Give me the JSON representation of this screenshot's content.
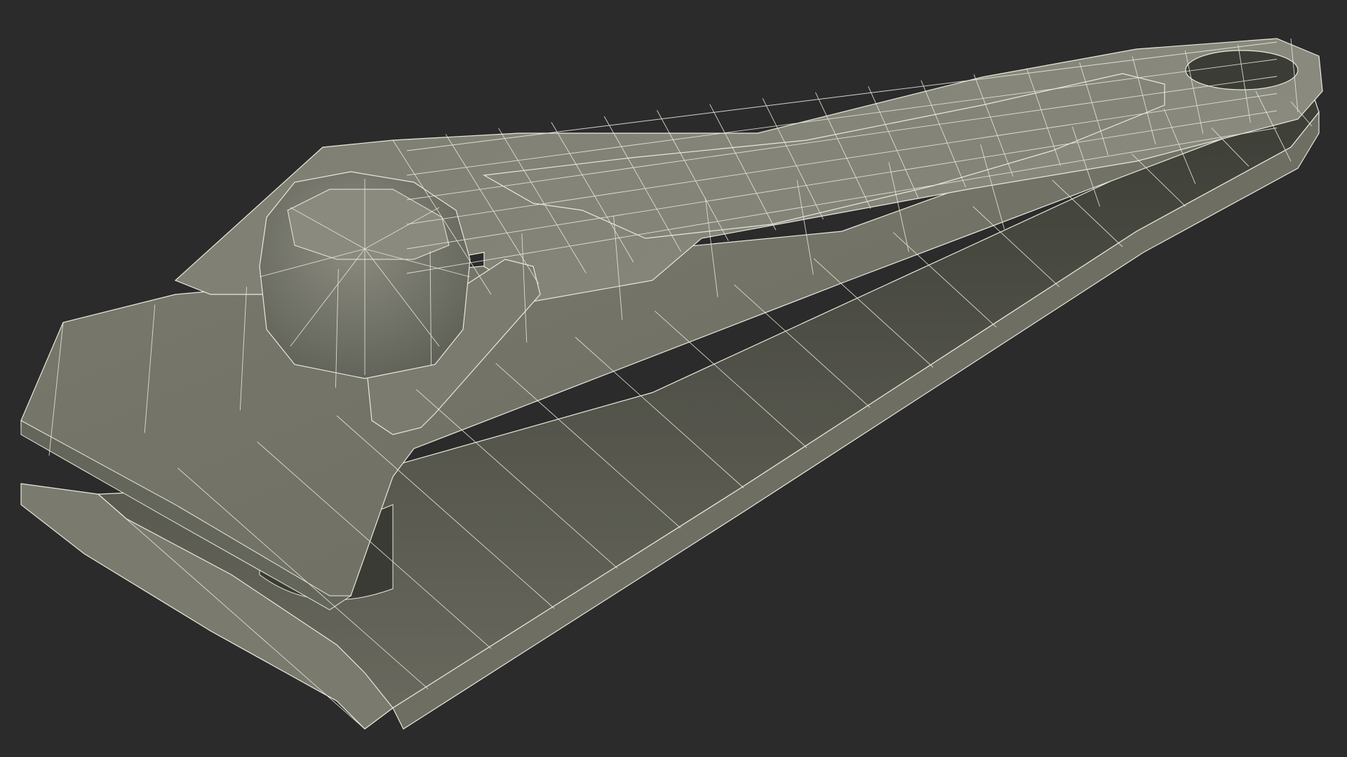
{
  "render": {
    "subject": "nail-clipper-wireframe",
    "background_color": "#2b2b2b",
    "surface_color": "#7d7d72",
    "shadow_color": "#2f302b",
    "wire_color": "#e8e8dc"
  }
}
